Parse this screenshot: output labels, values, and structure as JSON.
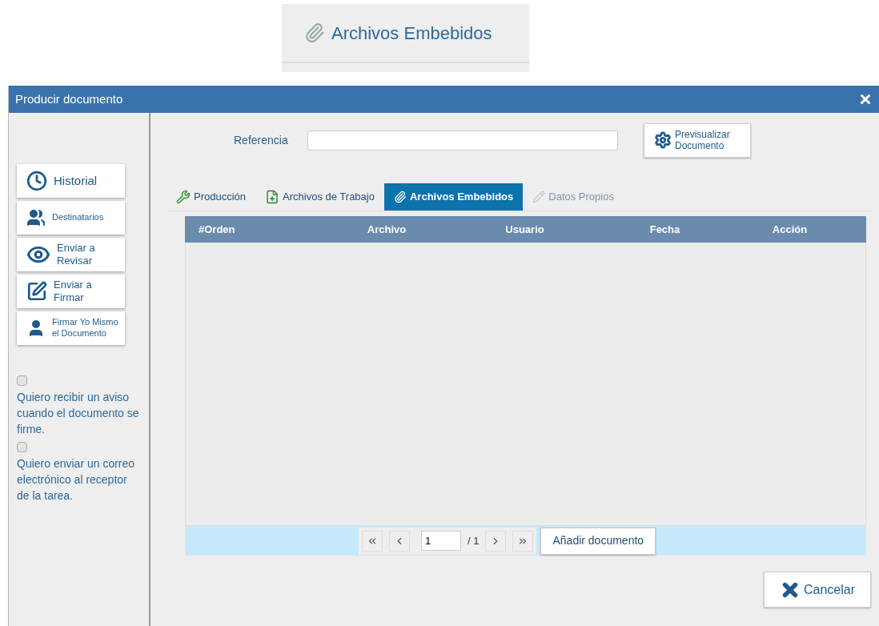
{
  "callout": {
    "label": "Archivos Embebidos"
  },
  "window": {
    "title": "Producir documento"
  },
  "sidebar": {
    "actions": [
      {
        "kind": "history",
        "lines": [
          "Historial"
        ]
      },
      {
        "kind": "people",
        "lines": [
          "Destinatarios"
        ]
      },
      {
        "kind": "eye",
        "lines": [
          "Enviar a",
          "Revisar"
        ]
      },
      {
        "kind": "sign",
        "lines": [
          "Enviar a",
          "Firmar"
        ]
      },
      {
        "kind": "person",
        "lines": [
          "Firmar Yo Mismo",
          "el Documento"
        ]
      }
    ],
    "options": [
      {
        "label": "Quiero recibir un aviso cuando el documento se firme.",
        "checked": false
      },
      {
        "label": "Quiero enviar un correo electrónico al receptor de la tarea.",
        "checked": false
      }
    ]
  },
  "reference": {
    "label": "Referencia"
  },
  "preview_button": {
    "lines": [
      "Previsualizar",
      "Documento"
    ]
  },
  "tabs": [
    {
      "kind": "tools",
      "label": "Producción",
      "selected": false,
      "disabled": false
    },
    {
      "kind": "file-add",
      "label": "Archivos de Trabajo",
      "selected": false,
      "disabled": false
    },
    {
      "kind": "attach",
      "label": "Archivos Embebidos",
      "selected": true,
      "disabled": false
    },
    {
      "kind": "edit",
      "label": "Datos Propios",
      "selected": false,
      "disabled": true
    }
  ],
  "table": {
    "columns": [
      "#Orden",
      "Archivo",
      "Usuario",
      "Fecha",
      "Acción"
    ]
  },
  "pager": {
    "page": "1",
    "total": "/ 1",
    "add_button": "Añadir documento"
  },
  "cancel_button": "Cancelar"
}
